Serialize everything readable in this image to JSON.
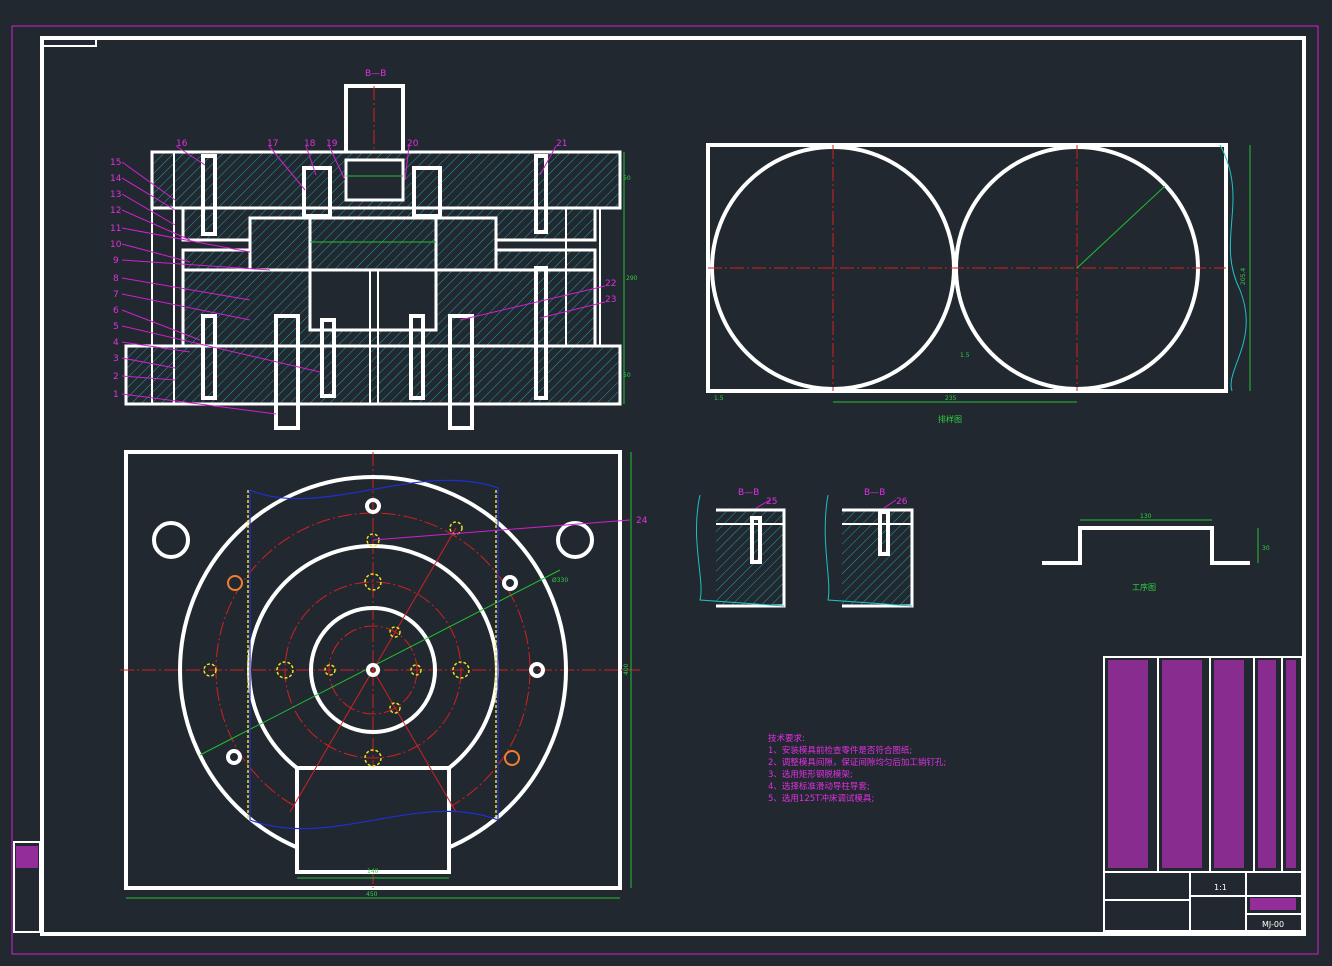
{
  "drawing": {
    "views": {
      "section_label": "B—B",
      "layout_title": "排样图",
      "workpiece_title": "工序图"
    },
    "part_numbers_left": [
      "15",
      "14",
      "13",
      "12",
      "11",
      "10",
      "9",
      "8",
      "7",
      "6",
      "5",
      "4",
      "3",
      "2",
      "1"
    ],
    "part_numbers_top": [
      "16",
      "17",
      "18",
      "19",
      "20",
      "21"
    ],
    "part_numbers_right": [
      "22",
      "23"
    ],
    "detail_numbers": [
      "25",
      "26",
      "24"
    ],
    "dimensions": {
      "section_height": "290",
      "top_plate": "50",
      "bottom_plate": "50",
      "layout_width": "235",
      "layout_gap": "1.5",
      "layout_edge": "1.5",
      "layout_height": "205.4",
      "plan_width": "450",
      "plan_height": "400",
      "plan_slot": "140",
      "plan_dia": "Ø330",
      "work_width": "130",
      "work_height": "30"
    },
    "tech_requirements": {
      "heading": "技术要求:",
      "items": [
        "1、安装模具前检查零件是否符合图纸;",
        "2、调整模具间隙，保证间隙均匀后加工销钉孔;",
        "3、选用矩形钢脱模架;",
        "4、选择标准滑动导柱导套;",
        "5、选用125T冲床调试模具;"
      ]
    },
    "title_block": {
      "scale": "1:1",
      "sheet_no": "MJ-00"
    },
    "colors": {
      "background": "#212830",
      "outline": "#ffffff",
      "centerline": "#d42020",
      "dimension": "#22c030",
      "leader": "#d020d0",
      "hidden": "#2030d0"
    }
  }
}
